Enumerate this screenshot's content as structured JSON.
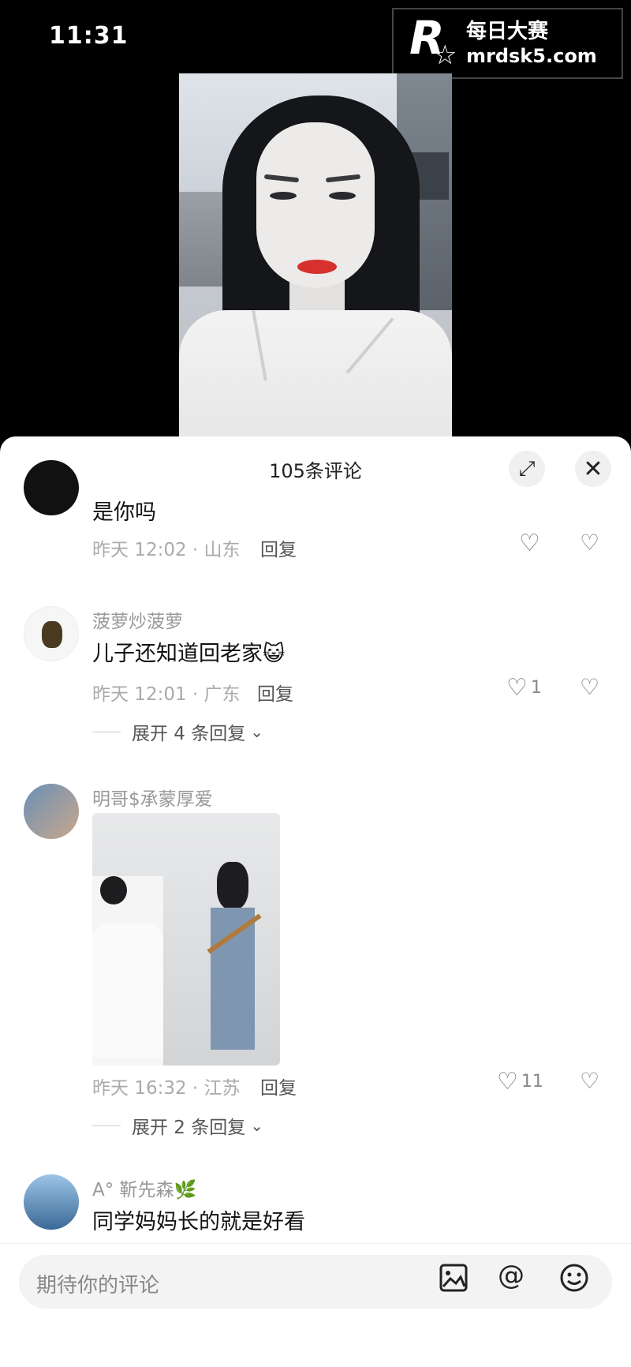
{
  "status_bar": {
    "time": "11:31"
  },
  "watermark": {
    "logo_letter": "R",
    "title": "每日大赛",
    "url": "mrdsk5.com"
  },
  "comments_panel": {
    "title": "105条评论",
    "expand_icon": "expand-icon",
    "close_icon": "close-icon",
    "comments": [
      {
        "username": "",
        "text": "是你吗",
        "meta": "昨天 12:02 · 山东",
        "reply_label": "回复",
        "likes": "",
        "expand_label": ""
      },
      {
        "username": "菠萝炒菠萝",
        "text": "儿子还知道回老家",
        "emoji": "😺",
        "meta": "昨天 12:01 · 广东",
        "reply_label": "回复",
        "likes": "1",
        "expand_label": "展开 4 条回复"
      },
      {
        "username": "明哥$承蒙厚爱",
        "text": "",
        "meta": "昨天 16:32 · 江苏",
        "reply_label": "回复",
        "likes": "11",
        "expand_label": "展开 2 条回复"
      },
      {
        "username": "A° 靳先森",
        "emoji": "🌿",
        "text": "同学妈妈长的就是好看",
        "meta": "",
        "reply_label": "",
        "likes": "",
        "expand_label": ""
      }
    ]
  },
  "comment_input": {
    "placeholder": "期待你的评论",
    "icons": [
      "image-icon",
      "at-icon",
      "emoji-icon"
    ],
    "at_symbol": "@"
  }
}
